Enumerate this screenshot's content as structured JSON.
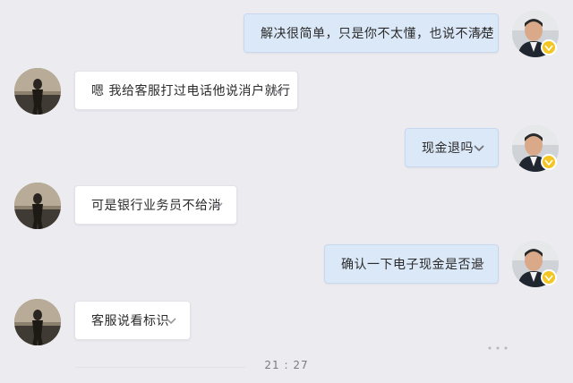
{
  "messages": [
    {
      "side": "out",
      "text": "解决很简单，只是你不太懂，也说不清楚"
    },
    {
      "side": "in",
      "text": "嗯 我给客服打过电话他说消户就行"
    },
    {
      "side": "out",
      "text": "现金退吗"
    },
    {
      "side": "in",
      "text": "可是银行业务员不给消"
    },
    {
      "side": "out",
      "text": "确认一下电子现金是否退"
    },
    {
      "side": "in",
      "text": "客服说看标识"
    }
  ],
  "time_label": "21 : 27",
  "icons": {
    "more": "chevron-down-icon",
    "verified": "verified-badge-icon"
  },
  "colors": {
    "background": "#ebebf0",
    "incoming_bubble": "#ffffff",
    "outgoing_bubble": "#dbe8f8",
    "badge": "#f3c623"
  }
}
